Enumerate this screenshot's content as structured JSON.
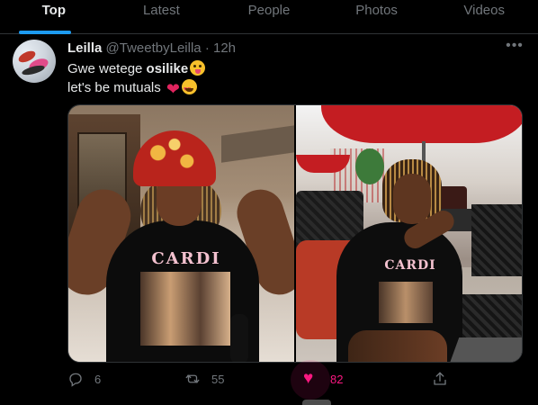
{
  "tabs": [
    "Top",
    "Latest",
    "People",
    "Photos",
    "Videos"
  ],
  "tweet": {
    "display_name": "Leilla",
    "handle": "@TweetbyLeilla",
    "separator": "·",
    "time": "12h",
    "text_line1_prefix": "Gwe wetege ",
    "text_line1_bold": "osilike",
    "text_line2": "let's be mutuals",
    "photo_left_shirt_text": "CARDI",
    "photo_right_shirt_text": "CARDI"
  },
  "actions": {
    "reply_count": "6",
    "retweet_count": "55",
    "like_count": "82"
  },
  "colors": {
    "accent": "#1d9bf0",
    "like": "#f91880",
    "muted": "#71767b",
    "background": "#000000"
  },
  "icons": [
    "more-icon",
    "reply-icon",
    "retweet-icon",
    "like-icon",
    "share-icon"
  ]
}
